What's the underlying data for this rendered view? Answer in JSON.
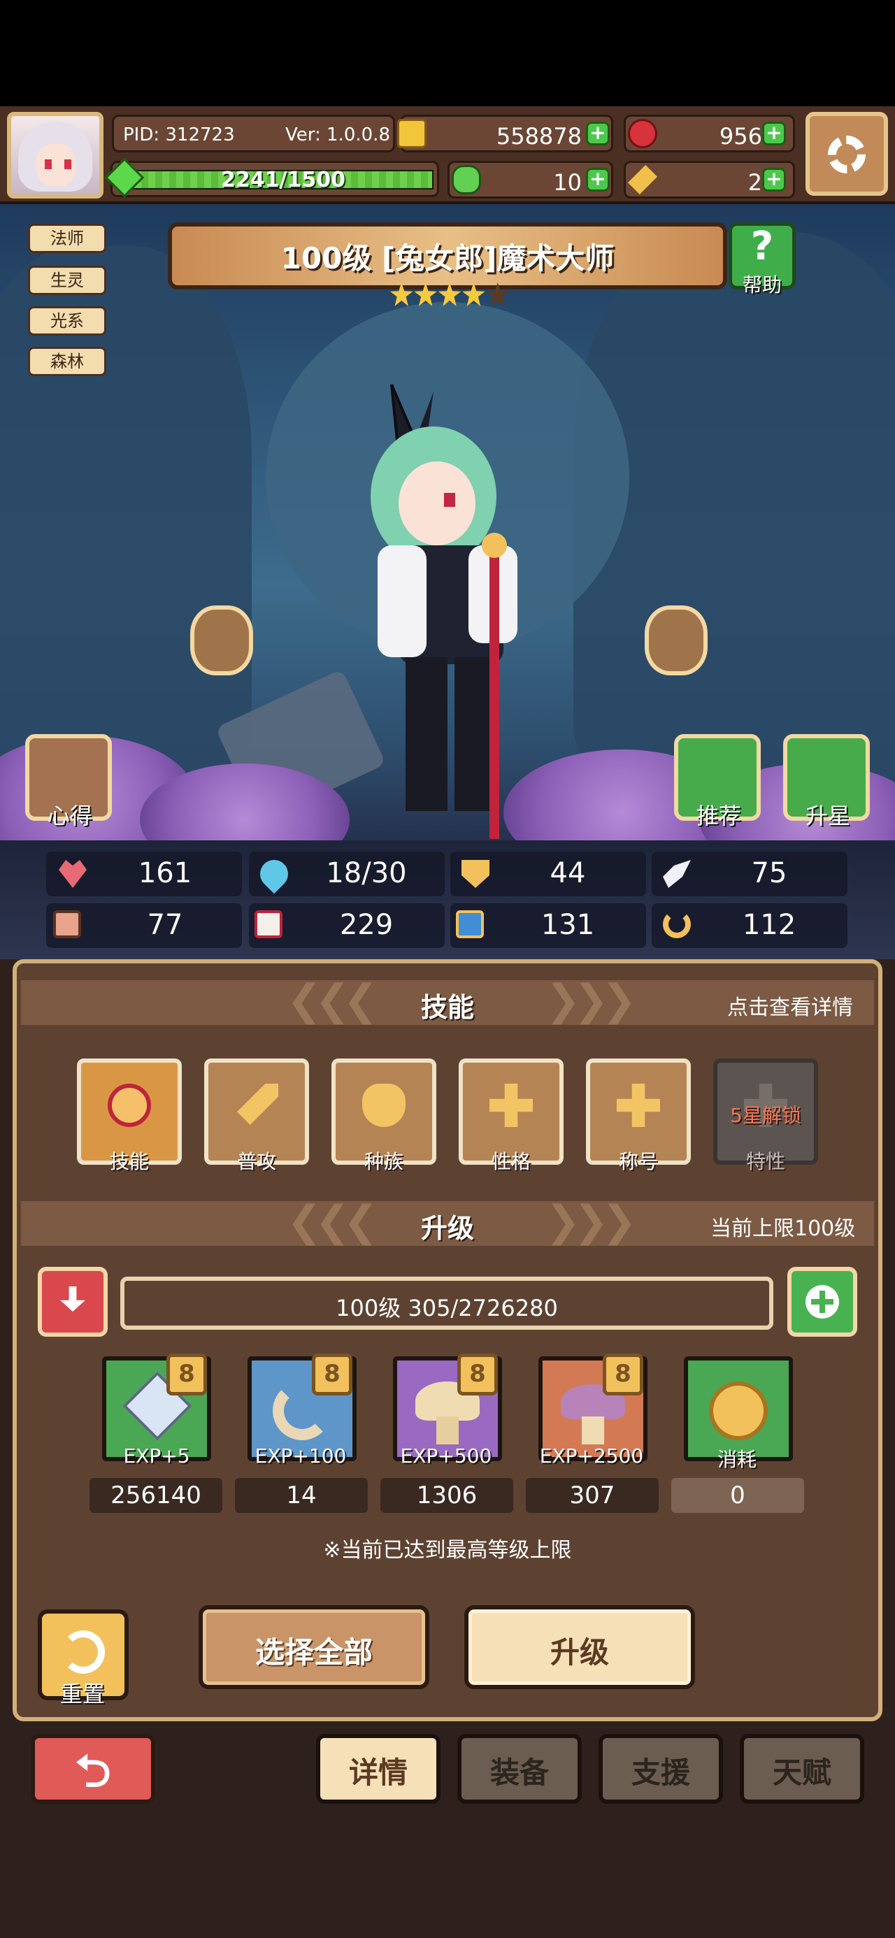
{
  "header": {
    "pid": "PID: 312723",
    "version": "Ver: 1.0.0.8",
    "exp_progress": "2241/1500",
    "gold": "558878",
    "rubies": "956",
    "clovers": "10",
    "tickets": "2",
    "add_symbol": "+"
  },
  "tags": [
    "法师",
    "生灵",
    "光系",
    "森林"
  ],
  "hero": {
    "title": "100级  [兔女郎]魔术大师",
    "stars_filled": 4,
    "stars_total": 5
  },
  "help": {
    "symbol": "?",
    "label": "帮助"
  },
  "scene_buttons": {
    "insights": "心得",
    "recommend": "推荐",
    "star_up": "升星"
  },
  "stats": {
    "hp": "161",
    "mana": "18/30",
    "defense": "44",
    "speed": "75",
    "attack": "77",
    "magic": "229",
    "resist": "131",
    "luck": "112"
  },
  "skills_section": {
    "title": "技能",
    "hint": "点击查看详情",
    "cards": [
      {
        "label": "技能",
        "locked_text": ""
      },
      {
        "label": "普攻",
        "locked_text": ""
      },
      {
        "label": "种族",
        "locked_text": ""
      },
      {
        "label": "性格",
        "locked_text": ""
      },
      {
        "label": "称号",
        "locked_text": ""
      },
      {
        "label": "特性",
        "locked_text": "5星解锁"
      }
    ]
  },
  "upgrade_section": {
    "title": "升级",
    "hint": "当前上限100级",
    "level_text": "100级  305/2726280",
    "items": [
      {
        "label": "EXP+5",
        "count": "256140",
        "badge": "8"
      },
      {
        "label": "EXP+100",
        "count": "14",
        "badge": "8"
      },
      {
        "label": "EXP+500",
        "count": "1306",
        "badge": "8"
      },
      {
        "label": "EXP+2500",
        "count": "307",
        "badge": "8"
      },
      {
        "label": "消耗",
        "count": "0",
        "badge": ""
      }
    ],
    "note": "※当前已达到最高等级上限"
  },
  "actions": {
    "reset": "重置",
    "select_all": "选择全部",
    "upgrade": "升级"
  },
  "nav": {
    "back_symbol": "⮌",
    "tabs": [
      "详情",
      "装备",
      "支援",
      "天赋"
    ]
  },
  "colors": {
    "panel_bg": "#5d4232",
    "panel_border": "#d2b07a",
    "accent_gold": "#f2c15c",
    "green_button": "#48b251",
    "red_button": "#d8484d"
  }
}
